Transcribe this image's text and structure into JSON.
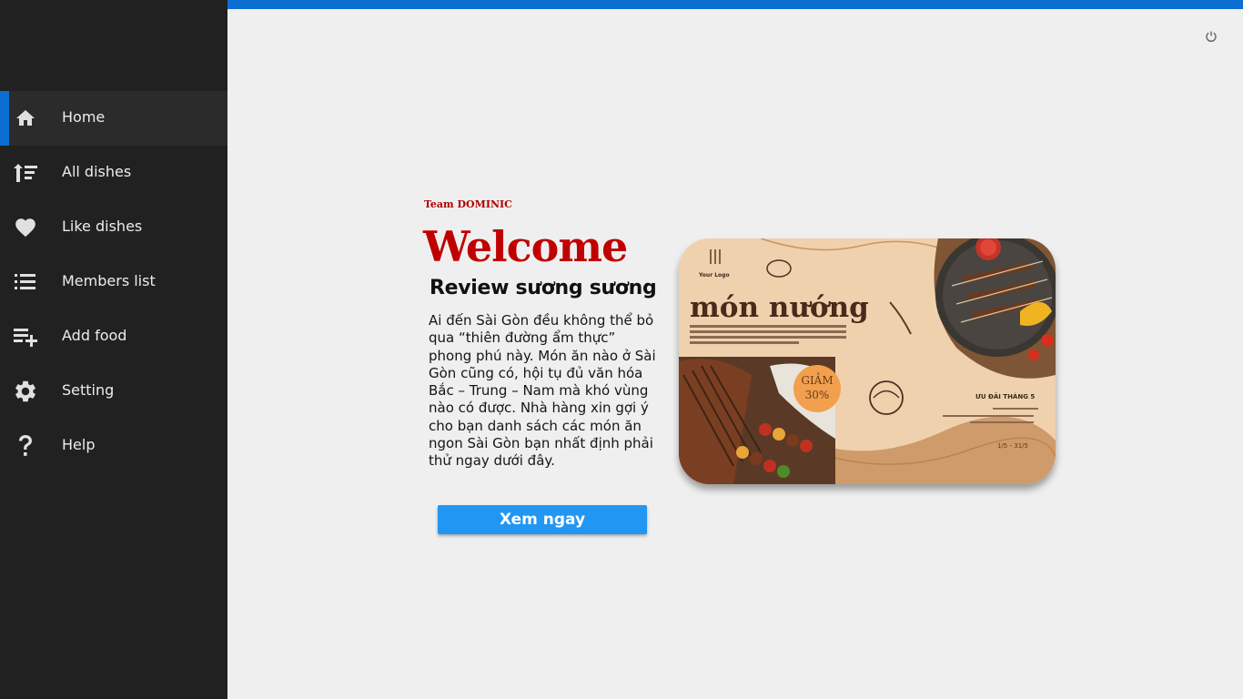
{
  "sidebar": {
    "items": [
      {
        "label": "Home",
        "icon": "home-icon",
        "active": true
      },
      {
        "label": "All dishes",
        "icon": "sort-icon"
      },
      {
        "label": "Like dishes",
        "icon": "heart-icon"
      },
      {
        "label": "Members list",
        "icon": "list-icon"
      },
      {
        "label": "Add food",
        "icon": "playlist-add-icon"
      },
      {
        "label": "Setting",
        "icon": "gear-icon"
      },
      {
        "label": "Help",
        "icon": "help-icon"
      }
    ]
  },
  "header": {
    "power_icon": "power-icon"
  },
  "main": {
    "team": "Team DOMINIC",
    "title": "Welcome",
    "subtitle": "Review sương sương",
    "description": "Ai đến Sài Gòn đều không thể bỏ qua “thiên đường ẩm thực” phong phú này. Món ăn nào ở Sài Gòn cũng có, hội tụ đủ văn hóa Bắc – Trung – Nam mà khó vùng nào có được. Nhà hàng xin gợi ý cho bạn danh sách các món ăn ngon Sài Gòn bạn nhất định phải thử ngay dưới đây.",
    "cta_label": "Xem  ngay",
    "banner": {
      "logo": "Your Logo",
      "heading": "món nướng",
      "discount_line1": "GIẢM",
      "discount_line2": "30%",
      "promo": "ƯU ĐÃI THÁNG 5",
      "dates": "1/5 - 31/5"
    }
  },
  "colors": {
    "accent": "#0b6fd1",
    "sidebar": "#212121",
    "title": "#c00000",
    "button": "#2196f3"
  }
}
